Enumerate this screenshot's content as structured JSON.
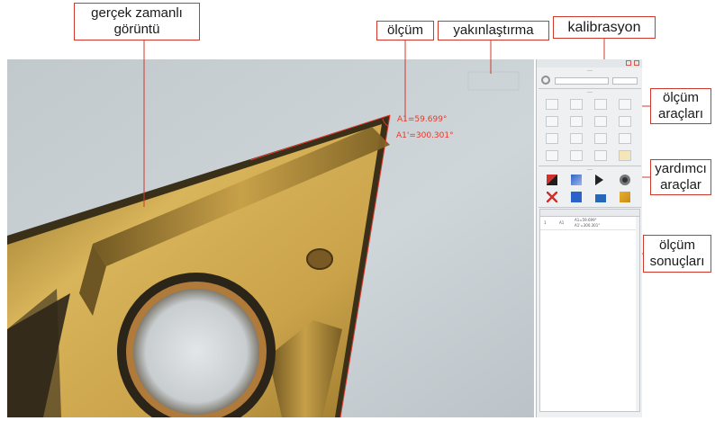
{
  "callouts": {
    "live_view": {
      "line1": "gerçek zamanlı",
      "line2": "görüntü"
    },
    "measure": "ölçüm",
    "zoom": "yakınlaştırma",
    "calibration": "kalibrasyon",
    "measure_tools": {
      "line1": "ölçüm",
      "line2": "araçları"
    },
    "aux_tools": {
      "line1": "yardımcı",
      "line2": "araçlar"
    },
    "results": {
      "line1": "ölçüm",
      "line2": "sonuçları"
    }
  },
  "measurement": {
    "a1": "A1=59.699°",
    "a1_prime": "A1'=300.301°"
  },
  "colors": {
    "callout_border": "#d0382b",
    "measure_red": "#e23a2c",
    "insert_gold": "#c9a44a",
    "background_blue_grey": "#c9d0d4"
  },
  "panel": {
    "toolbar_icons": [
      "minimize-icon",
      "close-icon"
    ],
    "settings_icon": "gear-icon",
    "results_columns": [
      "",
      "",
      ""
    ],
    "results_rows": [
      {
        "index": "1",
        "type": "A1",
        "value_line1": "A1=59.699°",
        "value_line2": "A1'=300.301°"
      }
    ]
  }
}
